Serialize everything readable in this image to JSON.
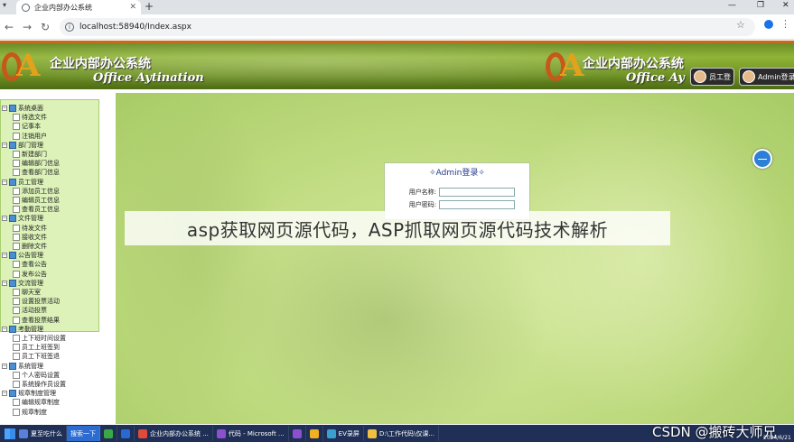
{
  "browser": {
    "tab_title": "企业内部办公系统",
    "tab_close": "✕",
    "new_tab": "+",
    "url": "localhost:58940/Index.aspx",
    "win_min": "—",
    "win_max": "❐",
    "win_close": "✕"
  },
  "banner": {
    "title_cn": "企业内部办公系统",
    "title_en": "Office Aytination",
    "title_en_partial": "Office Ay",
    "logo_text": "A",
    "users": [
      {
        "label": "员工登"
      },
      {
        "label": "Admin登录"
      }
    ]
  },
  "sidebar": {
    "groups": [
      {
        "label": "系统桌面",
        "items": [
          "待选文件",
          "记事本",
          "注销用户"
        ]
      },
      {
        "label": "部门管理",
        "items": [
          "新建部门",
          "编辑部门信息",
          "查看部门信息"
        ]
      },
      {
        "label": "员工管理",
        "items": [
          "添加员工信息",
          "编辑员工信息",
          "查看员工信息"
        ]
      },
      {
        "label": "文件管理",
        "items": [
          "待发文件",
          "接收文件",
          "删除文件"
        ]
      },
      {
        "label": "公告管理",
        "items": [
          "查看公告",
          "发布公告"
        ]
      },
      {
        "label": "交流管理",
        "items": [
          "聊天室",
          "设置投票活动",
          "活动投票",
          "查看投票结果"
        ]
      },
      {
        "label": "考勤管理",
        "items": [
          "上下班时间设置",
          "员工上班签到",
          "员工下班签退"
        ]
      },
      {
        "label": "系统管理",
        "items": [
          "个人密码设置",
          "系统操作员设置"
        ]
      },
      {
        "label": "规章制度管理",
        "items": [
          "编辑规章制度",
          "规章制度"
        ]
      }
    ]
  },
  "login": {
    "title": "✧Admin登录✧",
    "username_label": "用户名称:",
    "password_label": "用户密码:",
    "username_value": "",
    "password_value": ""
  },
  "overlay": {
    "text": "asp获取网页源代码，ASP抓取网页源代码技术解析"
  },
  "taskbar": {
    "items": [
      {
        "label": "夏至吃什么",
        "color": "#5a7fd8"
      },
      {
        "label": "搜索一下",
        "color": ""
      },
      {
        "label": "",
        "color": "#3aa845"
      },
      {
        "label": "",
        "color": "#2a6ad0"
      },
      {
        "label": "企业内部办公系统 ...",
        "color": "#e24a3a"
      },
      {
        "label": "代码 - Microsoft ...",
        "color": "#8b4fd0"
      },
      {
        "label": "",
        "color": "#8b4fd0"
      },
      {
        "label": "",
        "color": "#f0b020"
      },
      {
        "label": "EV录屏",
        "color": "#3aa0d0"
      },
      {
        "label": "D:\\工作代码\\仅课...",
        "color": "#f0c040"
      }
    ],
    "watermark": "CSDN @搬砖大师兄",
    "clock": "2024/6/21"
  }
}
